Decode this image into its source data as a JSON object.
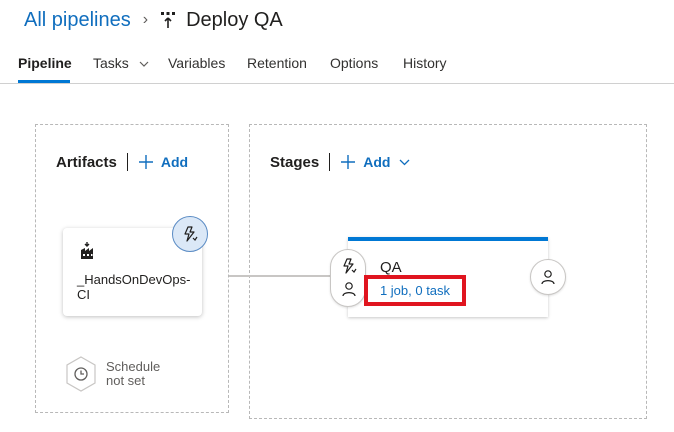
{
  "breadcrumb": {
    "parent": "All pipelines",
    "separator": "›",
    "title": "Deploy QA",
    "title_icon": "release-pipeline-icon"
  },
  "tabs": [
    {
      "label": "Pipeline",
      "active": true
    },
    {
      "label": "Tasks",
      "has_dropdown": true
    },
    {
      "label": "Variables"
    },
    {
      "label": "Retention"
    },
    {
      "label": "Options"
    },
    {
      "label": "History"
    }
  ],
  "artifacts": {
    "title": "Artifacts",
    "add_label": "Add",
    "card": {
      "name": "_HandsOnDevOps-CI",
      "icon": "build-icon"
    },
    "trigger_icon": "lightning-bolt-icon",
    "schedule": {
      "label_line1": "Schedule",
      "label_line2": "not set",
      "icon": "clock-icon"
    }
  },
  "stages": {
    "title": "Stages",
    "add_label": "Add",
    "stage": {
      "name": "QA",
      "tasks_link": "1 job, 0 task",
      "pre_deploy_icons": [
        "lightning-bolt-icon",
        "person-icon"
      ],
      "post_deploy_icon": "person-icon"
    }
  },
  "colors": {
    "accent": "#0078d4",
    "link": "#106ebe",
    "highlight_box": "#e0151f"
  }
}
